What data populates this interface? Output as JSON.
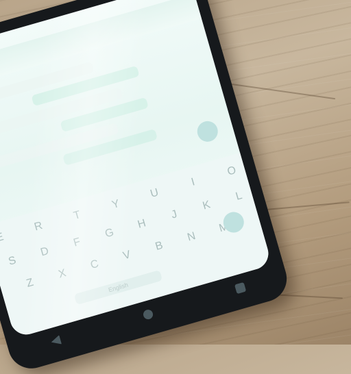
{
  "photo": {
    "subject": "smartphone-on-wooden-table"
  },
  "keyboard": {
    "rows": [
      [
        "E",
        "R",
        "T",
        "Y",
        "U",
        "I",
        "O"
      ],
      [
        "S",
        "D",
        "F",
        "G",
        "H",
        "J",
        "K",
        "L"
      ],
      [
        "Z",
        "X",
        "C",
        "V",
        "B",
        "N",
        "M"
      ]
    ],
    "space_label": "English"
  },
  "colors": {
    "table": "#c8b79e",
    "phone_body": "#16191c",
    "screen": "#eef7f6"
  }
}
